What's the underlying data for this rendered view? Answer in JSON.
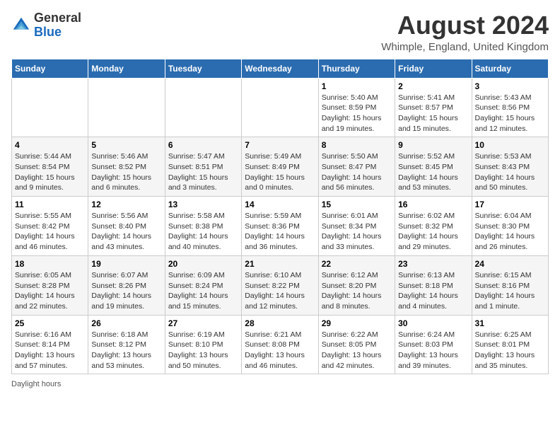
{
  "header": {
    "logo_general": "General",
    "logo_blue": "Blue",
    "month_year": "August 2024",
    "location": "Whimple, England, United Kingdom"
  },
  "days_of_week": [
    "Sunday",
    "Monday",
    "Tuesday",
    "Wednesday",
    "Thursday",
    "Friday",
    "Saturday"
  ],
  "weeks": [
    [
      {
        "num": "",
        "info": ""
      },
      {
        "num": "",
        "info": ""
      },
      {
        "num": "",
        "info": ""
      },
      {
        "num": "",
        "info": ""
      },
      {
        "num": "1",
        "info": "Sunrise: 5:40 AM\nSunset: 8:59 PM\nDaylight: 15 hours and 19 minutes."
      },
      {
        "num": "2",
        "info": "Sunrise: 5:41 AM\nSunset: 8:57 PM\nDaylight: 15 hours and 15 minutes."
      },
      {
        "num": "3",
        "info": "Sunrise: 5:43 AM\nSunset: 8:56 PM\nDaylight: 15 hours and 12 minutes."
      }
    ],
    [
      {
        "num": "4",
        "info": "Sunrise: 5:44 AM\nSunset: 8:54 PM\nDaylight: 15 hours and 9 minutes."
      },
      {
        "num": "5",
        "info": "Sunrise: 5:46 AM\nSunset: 8:52 PM\nDaylight: 15 hours and 6 minutes."
      },
      {
        "num": "6",
        "info": "Sunrise: 5:47 AM\nSunset: 8:51 PM\nDaylight: 15 hours and 3 minutes."
      },
      {
        "num": "7",
        "info": "Sunrise: 5:49 AM\nSunset: 8:49 PM\nDaylight: 15 hours and 0 minutes."
      },
      {
        "num": "8",
        "info": "Sunrise: 5:50 AM\nSunset: 8:47 PM\nDaylight: 14 hours and 56 minutes."
      },
      {
        "num": "9",
        "info": "Sunrise: 5:52 AM\nSunset: 8:45 PM\nDaylight: 14 hours and 53 minutes."
      },
      {
        "num": "10",
        "info": "Sunrise: 5:53 AM\nSunset: 8:43 PM\nDaylight: 14 hours and 50 minutes."
      }
    ],
    [
      {
        "num": "11",
        "info": "Sunrise: 5:55 AM\nSunset: 8:42 PM\nDaylight: 14 hours and 46 minutes."
      },
      {
        "num": "12",
        "info": "Sunrise: 5:56 AM\nSunset: 8:40 PM\nDaylight: 14 hours and 43 minutes."
      },
      {
        "num": "13",
        "info": "Sunrise: 5:58 AM\nSunset: 8:38 PM\nDaylight: 14 hours and 40 minutes."
      },
      {
        "num": "14",
        "info": "Sunrise: 5:59 AM\nSunset: 8:36 PM\nDaylight: 14 hours and 36 minutes."
      },
      {
        "num": "15",
        "info": "Sunrise: 6:01 AM\nSunset: 8:34 PM\nDaylight: 14 hours and 33 minutes."
      },
      {
        "num": "16",
        "info": "Sunrise: 6:02 AM\nSunset: 8:32 PM\nDaylight: 14 hours and 29 minutes."
      },
      {
        "num": "17",
        "info": "Sunrise: 6:04 AM\nSunset: 8:30 PM\nDaylight: 14 hours and 26 minutes."
      }
    ],
    [
      {
        "num": "18",
        "info": "Sunrise: 6:05 AM\nSunset: 8:28 PM\nDaylight: 14 hours and 22 minutes."
      },
      {
        "num": "19",
        "info": "Sunrise: 6:07 AM\nSunset: 8:26 PM\nDaylight: 14 hours and 19 minutes."
      },
      {
        "num": "20",
        "info": "Sunrise: 6:09 AM\nSunset: 8:24 PM\nDaylight: 14 hours and 15 minutes."
      },
      {
        "num": "21",
        "info": "Sunrise: 6:10 AM\nSunset: 8:22 PM\nDaylight: 14 hours and 12 minutes."
      },
      {
        "num": "22",
        "info": "Sunrise: 6:12 AM\nSunset: 8:20 PM\nDaylight: 14 hours and 8 minutes."
      },
      {
        "num": "23",
        "info": "Sunrise: 6:13 AM\nSunset: 8:18 PM\nDaylight: 14 hours and 4 minutes."
      },
      {
        "num": "24",
        "info": "Sunrise: 6:15 AM\nSunset: 8:16 PM\nDaylight: 14 hours and 1 minute."
      }
    ],
    [
      {
        "num": "25",
        "info": "Sunrise: 6:16 AM\nSunset: 8:14 PM\nDaylight: 13 hours and 57 minutes."
      },
      {
        "num": "26",
        "info": "Sunrise: 6:18 AM\nSunset: 8:12 PM\nDaylight: 13 hours and 53 minutes."
      },
      {
        "num": "27",
        "info": "Sunrise: 6:19 AM\nSunset: 8:10 PM\nDaylight: 13 hours and 50 minutes."
      },
      {
        "num": "28",
        "info": "Sunrise: 6:21 AM\nSunset: 8:08 PM\nDaylight: 13 hours and 46 minutes."
      },
      {
        "num": "29",
        "info": "Sunrise: 6:22 AM\nSunset: 8:05 PM\nDaylight: 13 hours and 42 minutes."
      },
      {
        "num": "30",
        "info": "Sunrise: 6:24 AM\nSunset: 8:03 PM\nDaylight: 13 hours and 39 minutes."
      },
      {
        "num": "31",
        "info": "Sunrise: 6:25 AM\nSunset: 8:01 PM\nDaylight: 13 hours and 35 minutes."
      }
    ]
  ],
  "legend": {
    "daylight_hours": "Daylight hours"
  }
}
